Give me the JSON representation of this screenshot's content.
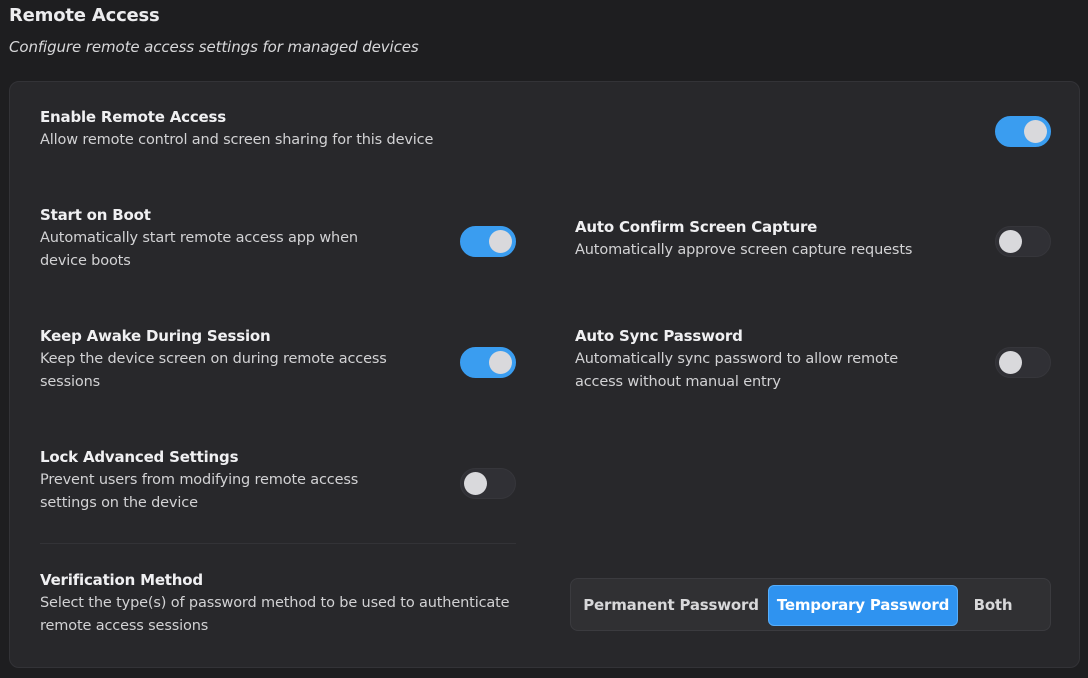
{
  "header": {
    "title": "Remote Access",
    "subtitle": "Configure remote access settings for managed devices"
  },
  "settings": {
    "enable_remote_access": {
      "title": "Enable Remote Access",
      "description": "Allow remote control and screen sharing for this device",
      "enabled": true
    },
    "start_on_boot": {
      "title": "Start on Boot",
      "description_line1": "Automatically start remote access app when",
      "description_line2": "device boots",
      "enabled": true
    },
    "auto_confirm_screen_capture": {
      "title": "Auto Confirm Screen Capture",
      "description": "Automatically approve screen capture requests",
      "enabled": false
    },
    "keep_awake": {
      "title": "Keep Awake During Session",
      "description_line1": "Keep the device screen on during remote access",
      "description_line2": "sessions",
      "enabled": true
    },
    "auto_sync_password": {
      "title": "Auto Sync Password",
      "description_line1": "Automatically sync password to allow remote",
      "description_line2": "access without manual entry",
      "enabled": false
    },
    "lock_advanced_settings": {
      "title": "Lock Advanced Settings",
      "description_line1": "Prevent users from modifying remote access",
      "description_line2": "settings on the device",
      "enabled": false
    }
  },
  "verification": {
    "title": "Verification Method",
    "description_line1": "Select the type(s) of password method to be used to authenticate",
    "description_line2": "remote access sessions",
    "options": [
      "Permanent Password",
      "Temporary Password",
      "Both"
    ],
    "selected": "Temporary Password"
  },
  "colors": {
    "accent": "#3a9df0",
    "background": "#1e1e20",
    "card": "#28282b"
  }
}
